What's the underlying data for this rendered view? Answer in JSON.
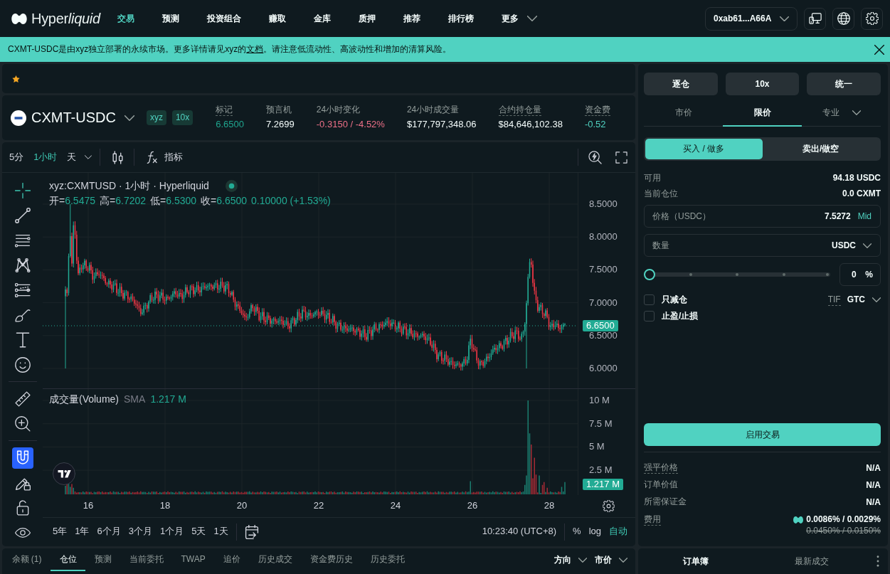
{
  "navbar": {
    "brand": {
      "regular": "Hyper",
      "italic": "liquid"
    },
    "menu": [
      {
        "label": "交易",
        "selected": true,
        "kind": "link"
      },
      {
        "label": "预测",
        "selected": false,
        "kind": "link"
      },
      {
        "label": "投资组合",
        "selected": false,
        "kind": "link"
      },
      {
        "label": "赚取",
        "selected": false,
        "kind": "link"
      },
      {
        "label": "金库",
        "selected": false,
        "kind": "link"
      },
      {
        "label": "质押",
        "selected": false,
        "kind": "link"
      },
      {
        "label": "推荐",
        "selected": false,
        "kind": "link"
      },
      {
        "label": "排行榜",
        "selected": false,
        "kind": "link"
      },
      {
        "label": "更多",
        "selected": false,
        "kind": "dropdown"
      }
    ],
    "wallet": "0xab61...A66A"
  },
  "notice": {
    "text_before": "CXMT-USDC是由xyz独立部署的永续市场。更多详情请见xyz的",
    "link": "文档",
    "text_after": "。请注意低流动性、高波动性和增加的清算风险。"
  },
  "market": {
    "symbol": "CXMT-USDC",
    "tags": [
      "xyz",
      "10x"
    ],
    "stats": [
      {
        "label": "标记",
        "value": "6.6500",
        "underlined": true,
        "color": "#1fa68f"
      },
      {
        "label": "预言机",
        "value": "7.2699",
        "underlined": false
      },
      {
        "label": "24小时变化",
        "value": "-0.3150 / -4.52%",
        "underlined": false,
        "color": "#ed7088"
      },
      {
        "label": "24小时成交量",
        "value": "$177,797,348.06",
        "underlined": false
      },
      {
        "label": "合约持仓量",
        "value": "$84,646,102.38",
        "underlined": true
      },
      {
        "label": "资金费",
        "value": "-0.52",
        "underlined": true,
        "color": "#50d2c1"
      }
    ]
  },
  "chart": {
    "intervals": [
      {
        "label": "5分",
        "selected": false,
        "kind": "button"
      },
      {
        "label": "1小时",
        "selected": true,
        "kind": "button"
      },
      {
        "label": "天",
        "selected": false,
        "kind": "dropdown"
      }
    ],
    "indicators_label": "指标",
    "tool_groups": [
      {
        "tools": [
          {
            "kind": "crosshair",
            "selected": true
          },
          {
            "kind": "trend_line",
            "selected": false
          },
          {
            "kind": "horizontal_lines",
            "selected": false
          },
          {
            "kind": "pattern",
            "selected": false
          },
          {
            "kind": "levels",
            "selected": false
          },
          {
            "kind": "brush",
            "selected": false
          },
          {
            "kind": "text",
            "selected": false
          },
          {
            "kind": "emoji",
            "selected": false
          }
        ]
      },
      {
        "tools": [
          {
            "kind": "ruler",
            "selected": false
          },
          {
            "kind": "zoom_in",
            "selected": false
          }
        ]
      },
      {
        "tools": [
          {
            "kind": "magnet",
            "on": true
          },
          {
            "kind": "pencil_lock",
            "on": false
          },
          {
            "kind": "lock",
            "on": false
          },
          {
            "kind": "eye",
            "on": false
          }
        ]
      }
    ],
    "legend": {
      "title": "xyz:CXMTUSD · 1小时 · Hyperliquid",
      "ohlc": [
        {
          "label": "开=",
          "value": "6.5475"
        },
        {
          "label": "高=",
          "value": "6.7202"
        },
        {
          "label": "低=",
          "value": "6.5300"
        },
        {
          "label": "收=",
          "value": "6.6500"
        }
      ],
      "change": "0.10000 (+1.53%)"
    },
    "price_axis": [
      "8.5000",
      "8.0000",
      "7.5000",
      "7.0000",
      "6.5000",
      "6.0000"
    ],
    "last_price": "6.6500",
    "volume_legend": {
      "title": "成交量(Volume)",
      "indicator": "SMA",
      "value": "1.217 M"
    },
    "volume_axis": [
      "10 M",
      "7.5 M",
      "5 M",
      "2.5 M"
    ],
    "last_volume": "1.217 M",
    "time_axis": [
      "16",
      "18",
      "20",
      "22",
      "24",
      "26",
      "28"
    ],
    "ranges": [
      "5年",
      "1年",
      "6个月",
      "3个月",
      "1个月",
      "5天",
      "1天"
    ],
    "clock": "10:23:40 (UTC+8)",
    "scale_options": [
      {
        "label": "%",
        "selected": false
      },
      {
        "label": "log",
        "selected": false
      },
      {
        "label": "自动",
        "selected": true
      }
    ]
  },
  "account_tabs": [
    {
      "label": "余额 (1)",
      "selected": false
    },
    {
      "label": "仓位",
      "selected": true
    },
    {
      "label": "预测",
      "selected": false
    },
    {
      "label": "当前委托",
      "selected": false
    },
    {
      "label": "TWAP",
      "selected": false
    },
    {
      "label": "追价",
      "selected": false
    },
    {
      "label": "历史成交",
      "selected": false
    },
    {
      "label": "资金费历史",
      "selected": false
    },
    {
      "label": "历史委托",
      "selected": false
    }
  ],
  "account_filters": [
    "方向",
    "市价"
  ],
  "order_form": {
    "margin_buttons": [
      "逐仓",
      "10x",
      "统一"
    ],
    "order_types": [
      {
        "label": "市价",
        "selected": false,
        "kind": "tab"
      },
      {
        "label": "限价",
        "selected": true,
        "kind": "tab"
      },
      {
        "label": "专业",
        "selected": false,
        "kind": "dropdown"
      }
    ],
    "sides": [
      {
        "label": "买入 / 做多",
        "selected": true
      },
      {
        "label": "卖出/做空",
        "selected": false
      }
    ],
    "balances": [
      {
        "label": "可用",
        "value": "94.18 USDC"
      },
      {
        "label": "当前仓位",
        "value": "0.0 CXMT"
      }
    ],
    "price_field": {
      "label": "价格（USDC）",
      "value": "7.5272",
      "action": "Mid"
    },
    "size_field": {
      "placeholder": "数量",
      "unit": "USDC"
    },
    "size_slider": {
      "level": 0
    },
    "percent_field": {
      "value": "0",
      "unit": "%"
    },
    "options": [
      {
        "label": "只减仓",
        "checked": false
      },
      {
        "label": "止盈/止损",
        "checked": false
      }
    ],
    "tif": {
      "label": "TIF",
      "value": "GTC"
    },
    "submit": "启用交易",
    "summary": [
      {
        "label": "强平价格",
        "value": "N/A",
        "underlined": true
      },
      {
        "label": "订单价值",
        "value": "N/A",
        "underlined": false
      },
      {
        "label": "所需保证金",
        "value": "N/A",
        "underlined": false
      }
    ],
    "fees": {
      "label": "费用",
      "value": "0.0086% / 0.0029%",
      "original_value": "0.0450% / 0.0150%"
    }
  },
  "book_tabs": [
    {
      "label": "订单簿",
      "selected": true
    },
    {
      "label": "最新成交",
      "selected": false
    }
  ]
}
